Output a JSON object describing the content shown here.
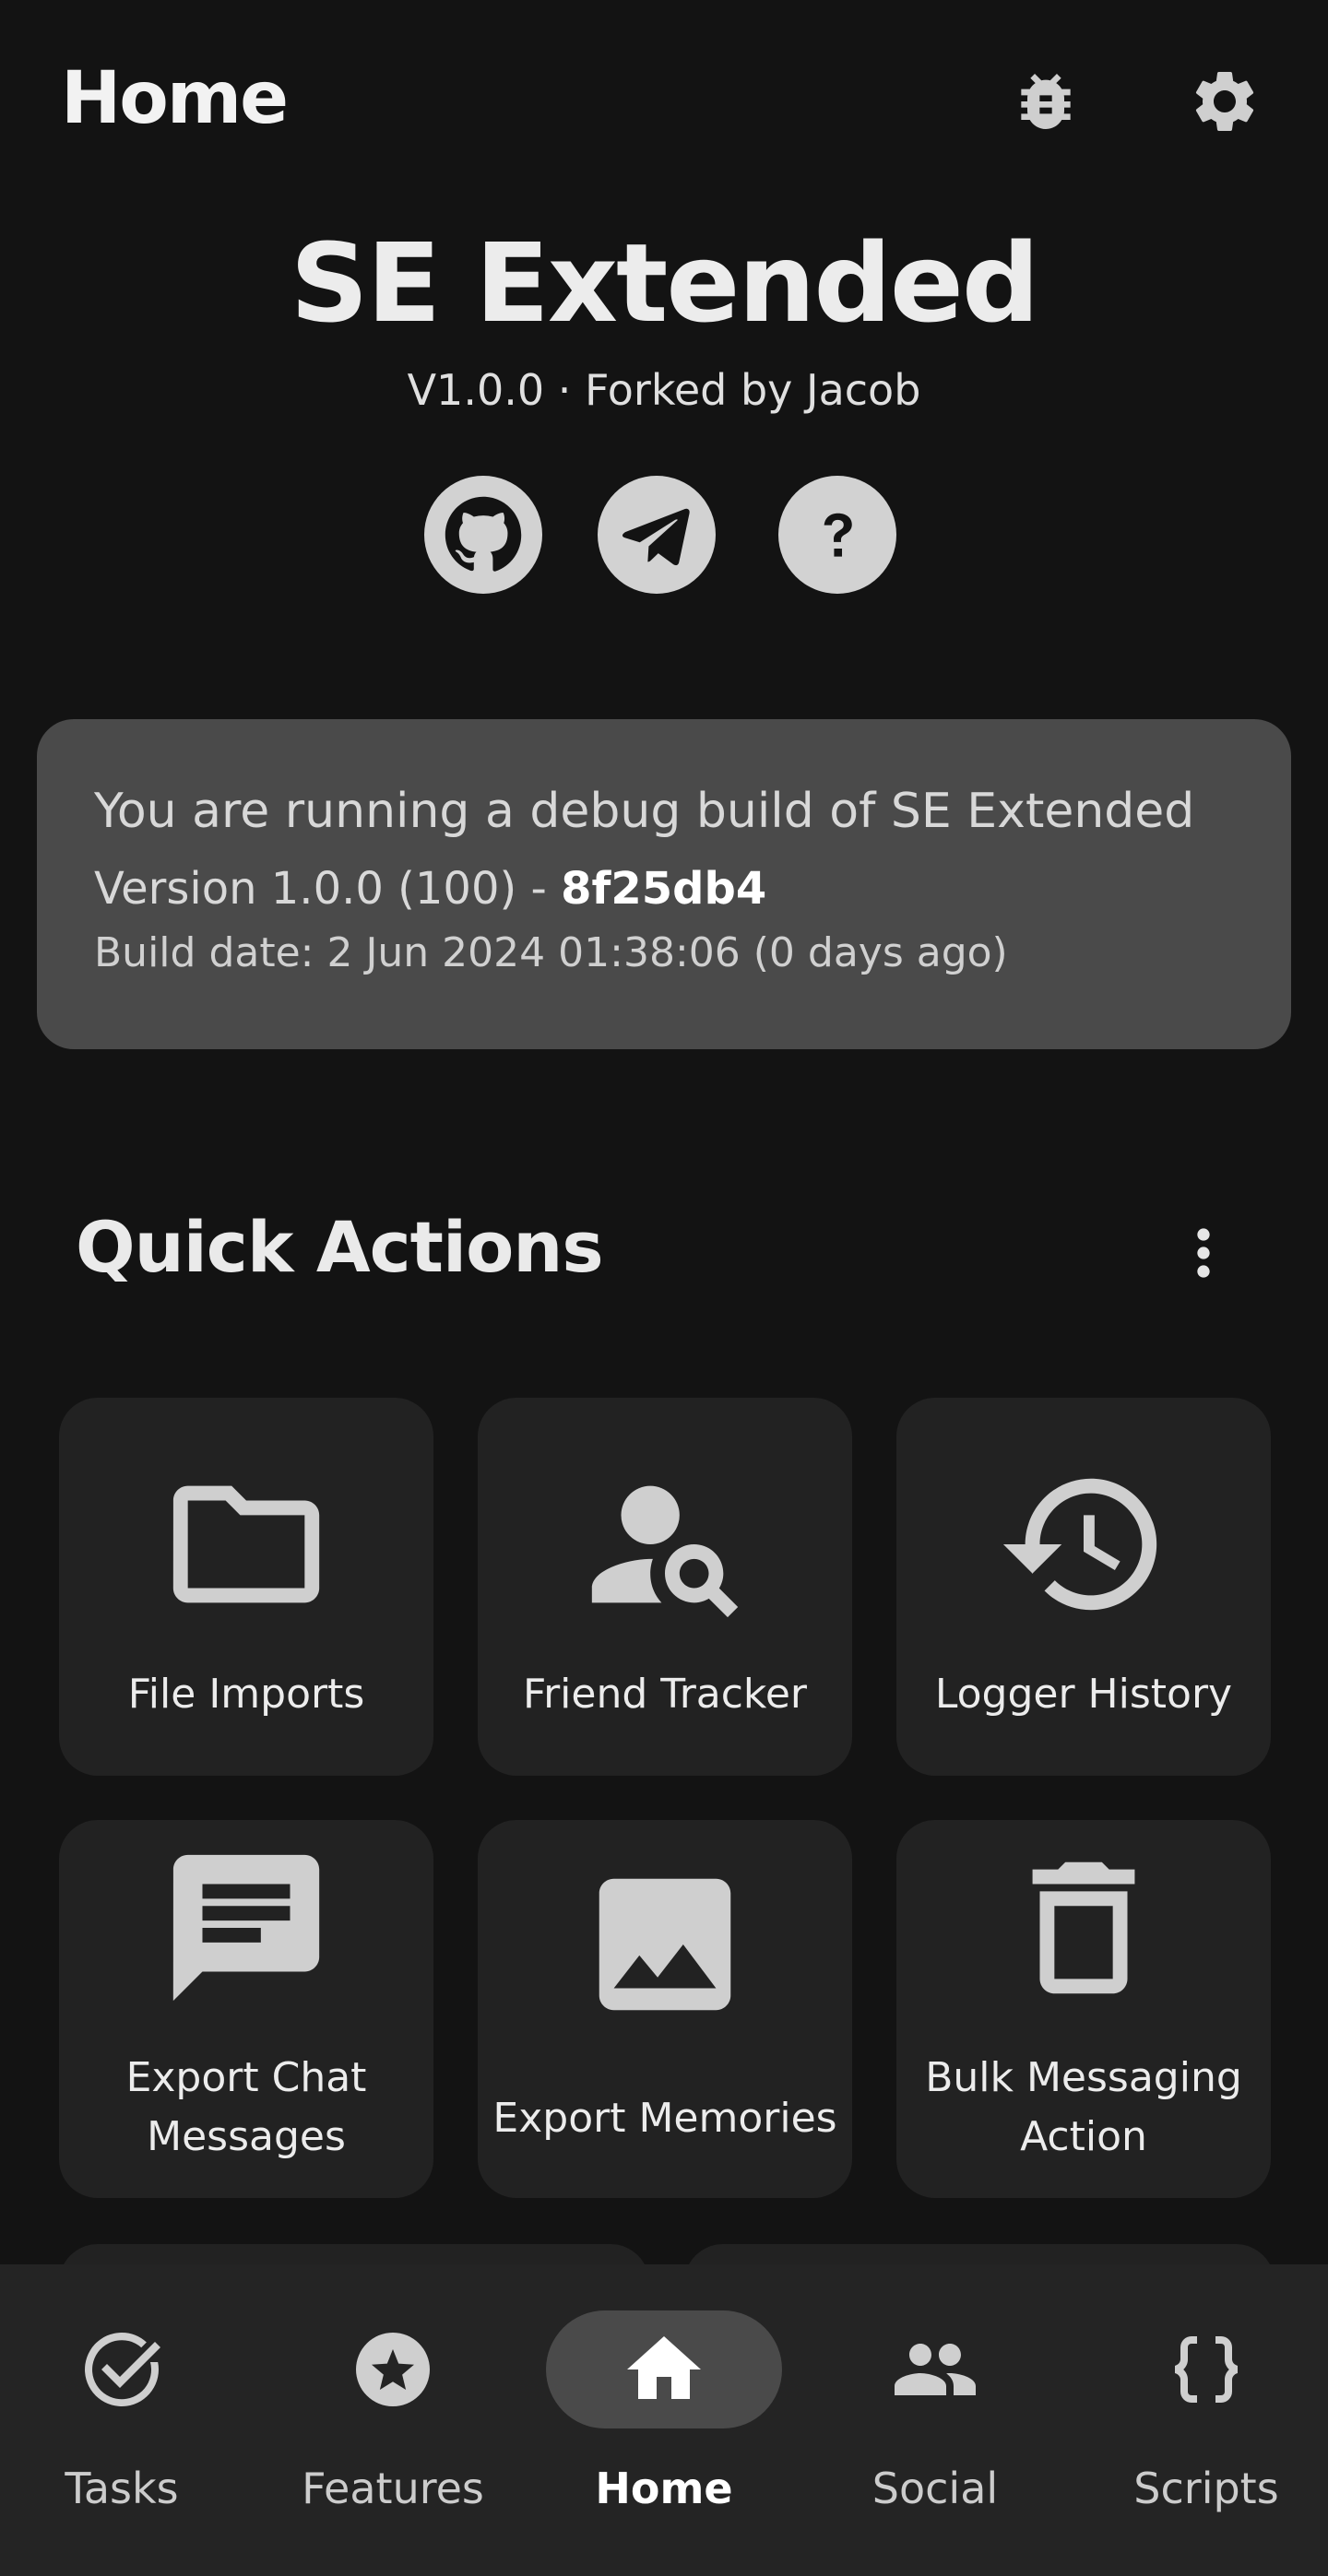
{
  "header": {
    "title": "Home",
    "icons": [
      "bug-icon",
      "gear-icon"
    ]
  },
  "app": {
    "name": "SE Extended",
    "subtitle": "V1.0.0 · Forked by Jacob",
    "links": [
      "github-icon",
      "telegram-icon",
      "help-icon"
    ]
  },
  "debug_card": {
    "line1": "You are running a debug build of SE Extended",
    "version_prefix": "Version 1.0.0 (100) - ",
    "commit_hash": "8f25db4",
    "build_date": "Build date: 2 Jun 2024 01:38:06 (0 days ago)"
  },
  "quick_actions": {
    "title": "Quick Actions",
    "items": [
      {
        "label": "File Imports",
        "icon": "folder-icon"
      },
      {
        "label": "Friend Tracker",
        "icon": "person-search-icon"
      },
      {
        "label": "Logger History",
        "icon": "history-icon"
      },
      {
        "label": "Export Chat Messages",
        "line1": "Export Chat",
        "line2": "Messages",
        "icon": "chat-icon"
      },
      {
        "label": "Export Memories",
        "icon": "image-icon"
      },
      {
        "label": "Bulk Messaging Action",
        "line1": "Bulk Messaging",
        "line2": "Action",
        "icon": "trash-icon"
      }
    ]
  },
  "nav": {
    "items": [
      {
        "label": "Tasks",
        "icon": "tasks-check-icon"
      },
      {
        "label": "Features",
        "icon": "star-icon"
      },
      {
        "label": "Home",
        "icon": "home-icon",
        "active": true
      },
      {
        "label": "Social",
        "icon": "people-icon"
      },
      {
        "label": "Scripts",
        "icon": "braces-icon"
      }
    ]
  },
  "colors": {
    "background": "#131313",
    "card": "#4a4a4a",
    "tile": "#222222",
    "nav_bar": "#242424",
    "active_pill": "#4a4a4a"
  }
}
